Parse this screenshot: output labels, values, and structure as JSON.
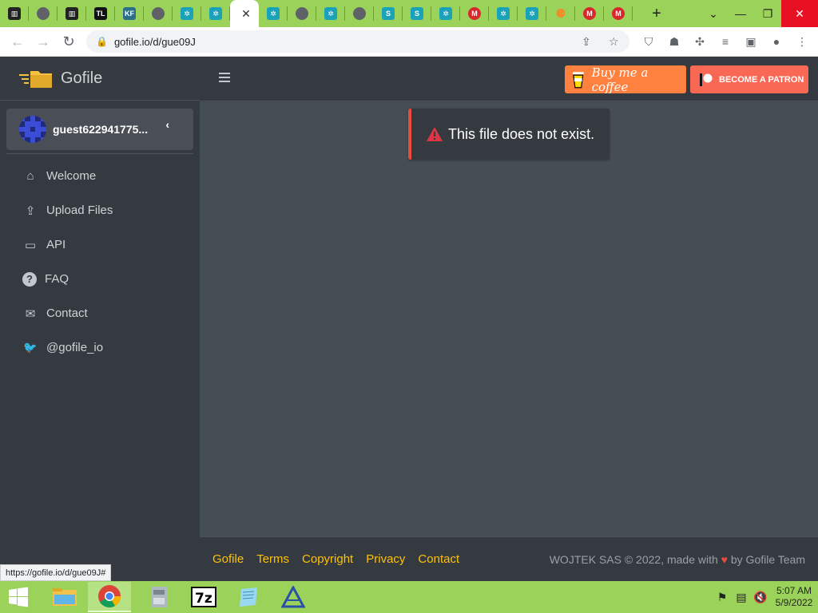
{
  "browser": {
    "tabs": [
      {
        "icon": "bank-icon",
        "color": "#222222",
        "glyph": "▥"
      },
      {
        "icon": "globe-icon",
        "color": "#5f6368",
        "glyph": ""
      },
      {
        "icon": "bank-icon",
        "color": "#222222",
        "glyph": "▥"
      },
      {
        "icon": "tl-icon",
        "color": "#111111",
        "glyph": "TL"
      },
      {
        "icon": "kf-icon",
        "color": "#2b6e8a",
        "glyph": "KF"
      },
      {
        "icon": "globe-icon",
        "color": "#5f6368",
        "glyph": ""
      },
      {
        "icon": "gear-teal-icon",
        "color": "#1aa3b8",
        "glyph": "✲"
      },
      {
        "icon": "gear-teal-icon",
        "color": "#1aa3b8",
        "glyph": "✲"
      },
      {
        "icon": "active-tab",
        "color": "#ffffff",
        "glyph": ""
      },
      {
        "icon": "gear-teal-icon",
        "color": "#1aa3b8",
        "glyph": "✲"
      },
      {
        "icon": "globe-icon",
        "color": "#5f6368",
        "glyph": ""
      },
      {
        "icon": "gear-teal-icon",
        "color": "#1aa3b8",
        "glyph": "✲"
      },
      {
        "icon": "globe-icon",
        "color": "#5f6368",
        "glyph": ""
      },
      {
        "icon": "s-icon",
        "color": "#1aa3b8",
        "glyph": "S"
      },
      {
        "icon": "s-icon",
        "color": "#1aa3b8",
        "glyph": "S"
      },
      {
        "icon": "gear-teal-icon",
        "color": "#1aa3b8",
        "glyph": "✲"
      },
      {
        "icon": "mega-icon",
        "color": "#d9272e",
        "glyph": "M"
      },
      {
        "icon": "gear-teal-icon",
        "color": "#1aa3b8",
        "glyph": "✲"
      },
      {
        "icon": "gear-teal-icon",
        "color": "#1aa3b8",
        "glyph": "✲"
      },
      {
        "icon": "orange-circle-icon",
        "color": "#f28c28",
        "glyph": "⚈"
      },
      {
        "icon": "mega-icon",
        "color": "#d9272e",
        "glyph": "M"
      },
      {
        "icon": "mega-icon",
        "color": "#d9272e",
        "glyph": "M"
      }
    ],
    "new_tab_label": "+",
    "url": "gofile.io/d/gue09J",
    "status_url": "https://gofile.io/d/gue09J#"
  },
  "app": {
    "brand": "Gofile",
    "username": "guest622941775...",
    "nav": [
      {
        "label": "Welcome",
        "icon": "home-icon",
        "glyph": "⌂"
      },
      {
        "label": "Upload Files",
        "icon": "file-upload-icon",
        "glyph": "⇪"
      },
      {
        "label": "API",
        "icon": "laptop-code-icon",
        "glyph": "▭"
      },
      {
        "label": "FAQ",
        "icon": "question-circle-icon",
        "glyph": "?"
      },
      {
        "label": "Contact",
        "icon": "envelope-icon",
        "glyph": "✉"
      },
      {
        "label": "@gofile_io",
        "icon": "twitter-icon",
        "glyph": "🐦"
      }
    ],
    "coffee_label": "Buy me a coffee",
    "patron_label": "BECOME A PATRON",
    "alert_text": "This file does not exist.",
    "footer_links": [
      "Gofile",
      "Terms",
      "Copyright",
      "Privacy",
      "Contact"
    ],
    "footer_left": "WOJTEK SAS © 2022, made with",
    "footer_right": "by Gofile Team"
  },
  "taskbar": {
    "time": "5:07 AM",
    "date": "5/9/2022"
  },
  "colors": {
    "accent_link": "#ffc107",
    "alert_border": "#e74c3c",
    "coffee": "#ff813f",
    "patron": "#f96854"
  }
}
